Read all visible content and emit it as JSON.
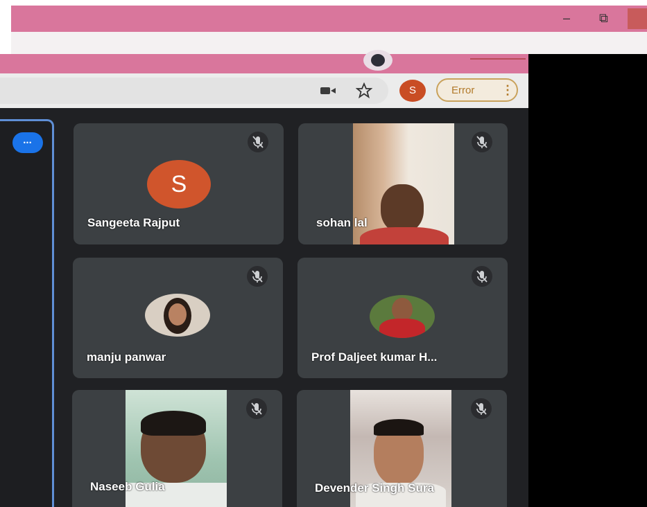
{
  "window": {
    "minimize_glyph": "–",
    "restore_glyph": "⧉",
    "accent": "#d9769c"
  },
  "toolbar": {
    "camera_icon": "camera-icon",
    "star_icon": "star-icon",
    "profile_letter": "S",
    "error_label": "Error",
    "menu_glyph": "⋮"
  },
  "sidebar": {
    "more_glyph": "•••"
  },
  "participants": [
    {
      "name": "Sangeeta Rajput",
      "initial": "S",
      "muted": true,
      "avatar_color": "#d0552c"
    },
    {
      "name": "sohan lal",
      "muted": true
    },
    {
      "name": "manju panwar",
      "muted": true
    },
    {
      "name": "Prof Daljeet kumar H...",
      "muted": true
    },
    {
      "name": "Naseeb Gulia",
      "muted": true
    },
    {
      "name": "Devender Singh Sura",
      "muted": true
    }
  ]
}
